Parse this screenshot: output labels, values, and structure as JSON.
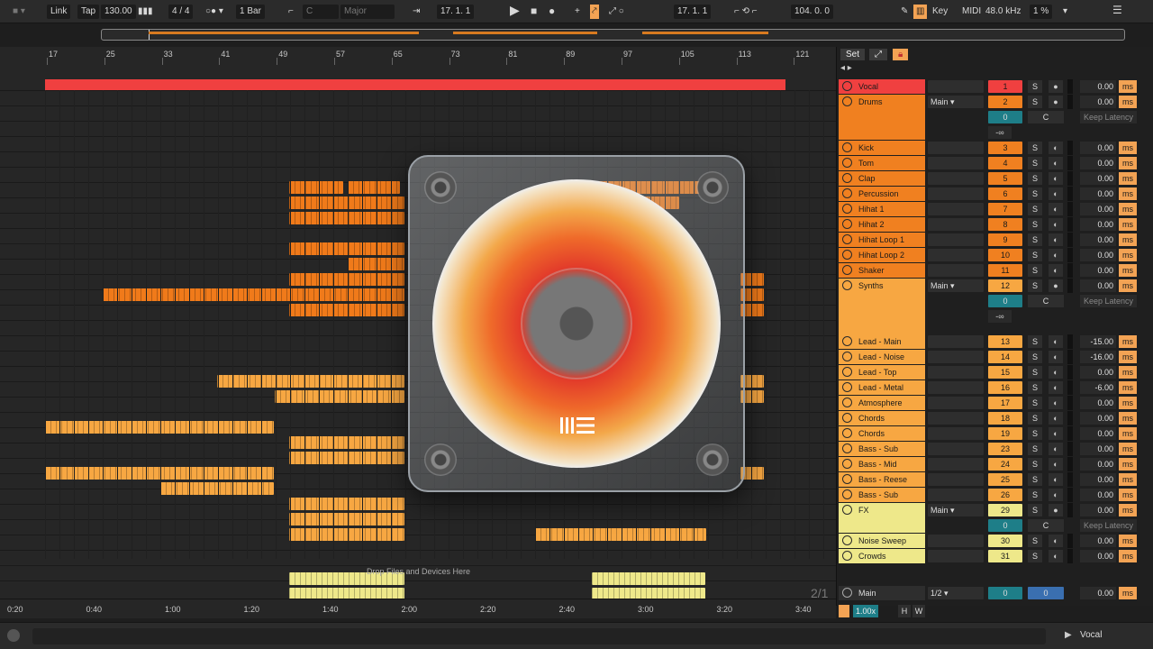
{
  "transport": {
    "link": "Link",
    "tap": "Tap",
    "tempo": "130.00",
    "signature": "4 / 4",
    "quantize": "1 Bar",
    "key": "C",
    "scale": "Major",
    "position": "17.  1.  1",
    "loop_start": "17.  1.  1",
    "loop_length": "104.  0.  0",
    "key_btn": "Key",
    "midi_btn": "MIDI",
    "sample_rate": "48.0 kHz",
    "cpu": "1 %"
  },
  "ruler": {
    "bars": [
      "17",
      "25",
      "33",
      "41",
      "49",
      "57",
      "65",
      "73",
      "81",
      "89",
      "97",
      "105",
      "113",
      "121"
    ]
  },
  "time_ruler": {
    "labels": [
      "0:20",
      "0:40",
      "1:00",
      "1:20",
      "1:40",
      "2:00",
      "2:20",
      "2:40",
      "3:00",
      "3:20",
      "3:40"
    ]
  },
  "arrangement": {
    "drop_hint": "Drop Files and Devices Here",
    "page_counter": "2/1"
  },
  "mixer": {
    "set_label": "Set",
    "keep_latency": "Keep Latency",
    "neg_inf": "-∞",
    "c_label": "C",
    "s_label": "S",
    "ms_label": "ms",
    "tracks": [
      {
        "name": "Vocal",
        "num": "1",
        "delay": "0.00",
        "color": "#f04040",
        "route": ""
      },
      {
        "name": "Drums",
        "num": "2",
        "delay": "0.00",
        "color": "#f08020",
        "route": "Main"
      },
      {
        "name": "Kick",
        "num": "3",
        "delay": "0.00",
        "color": "#f08020",
        "route": ""
      },
      {
        "name": "Tom",
        "num": "4",
        "delay": "0.00",
        "color": "#f08020",
        "route": ""
      },
      {
        "name": "Clap",
        "num": "5",
        "delay": "0.00",
        "color": "#f08020",
        "route": ""
      },
      {
        "name": "Percussion",
        "num": "6",
        "delay": "0.00",
        "color": "#f08020",
        "route": ""
      },
      {
        "name": "Hihat 1",
        "num": "7",
        "delay": "0.00",
        "color": "#f08020",
        "route": ""
      },
      {
        "name": "Hihat 2",
        "num": "8",
        "delay": "0.00",
        "color": "#f08020",
        "route": ""
      },
      {
        "name": "Hihat Loop 1",
        "num": "9",
        "delay": "0.00",
        "color": "#f08020",
        "route": ""
      },
      {
        "name": "Hihat Loop 2",
        "num": "10",
        "delay": "0.00",
        "color": "#f08020",
        "route": ""
      },
      {
        "name": "Shaker",
        "num": "11",
        "delay": "0.00",
        "color": "#f08020",
        "route": ""
      },
      {
        "name": "Synths",
        "num": "12",
        "delay": "0.00",
        "color": "#f7a742",
        "route": "Main"
      },
      {
        "name": "Lead - Main",
        "num": "13",
        "delay": "-15.00",
        "color": "#f7a742",
        "route": ""
      },
      {
        "name": "Lead - Noise",
        "num": "14",
        "delay": "-16.00",
        "color": "#f7a742",
        "route": ""
      },
      {
        "name": "Lead - Top",
        "num": "15",
        "delay": "0.00",
        "color": "#f7a742",
        "route": ""
      },
      {
        "name": "Lead - Metal",
        "num": "16",
        "delay": "-6.00",
        "color": "#f7a742",
        "route": ""
      },
      {
        "name": "Atmosphere",
        "num": "17",
        "delay": "0.00",
        "color": "#f7a742",
        "route": ""
      },
      {
        "name": "Chords",
        "num": "18",
        "delay": "0.00",
        "color": "#f7a742",
        "route": ""
      },
      {
        "name": "Chords",
        "num": "19",
        "delay": "0.00",
        "color": "#f7a742",
        "route": ""
      },
      {
        "name": "Bass - Sub",
        "num": "23",
        "delay": "0.00",
        "color": "#f7a742",
        "route": ""
      },
      {
        "name": "Bass - Mid",
        "num": "24",
        "delay": "0.00",
        "color": "#f7a742",
        "route": ""
      },
      {
        "name": "Bass - Reese",
        "num": "25",
        "delay": "0.00",
        "color": "#f7a742",
        "route": ""
      },
      {
        "name": "Bass - Sub",
        "num": "26",
        "delay": "0.00",
        "color": "#f7a742",
        "route": ""
      },
      {
        "name": "FX",
        "num": "29",
        "delay": "0.00",
        "color": "#eee88a",
        "route": "Main"
      },
      {
        "name": "Noise Sweep",
        "num": "30",
        "delay": "0.00",
        "color": "#eee88a",
        "route": ""
      },
      {
        "name": "Crowds",
        "num": "31",
        "delay": "0.00",
        "color": "#eee88a",
        "route": ""
      }
    ],
    "main": {
      "name": "Main",
      "route": "1/2",
      "send_a": "0",
      "send_b": "0",
      "delay": "0.00"
    },
    "zoom": "1.00x",
    "h": "H",
    "w": "W"
  },
  "status": {
    "selected_track": "Vocal"
  },
  "icons": {
    "play": "play-icon",
    "stop": "stop-icon",
    "record": "record-icon",
    "pencil": "pencil-icon",
    "menu": "menu-icon",
    "lock": "lock-icon"
  },
  "colors": {
    "accent": "#f3a354",
    "vocal": "#f04040",
    "drums": "#f08020",
    "synths": "#f7a742",
    "fx": "#eee88a"
  }
}
